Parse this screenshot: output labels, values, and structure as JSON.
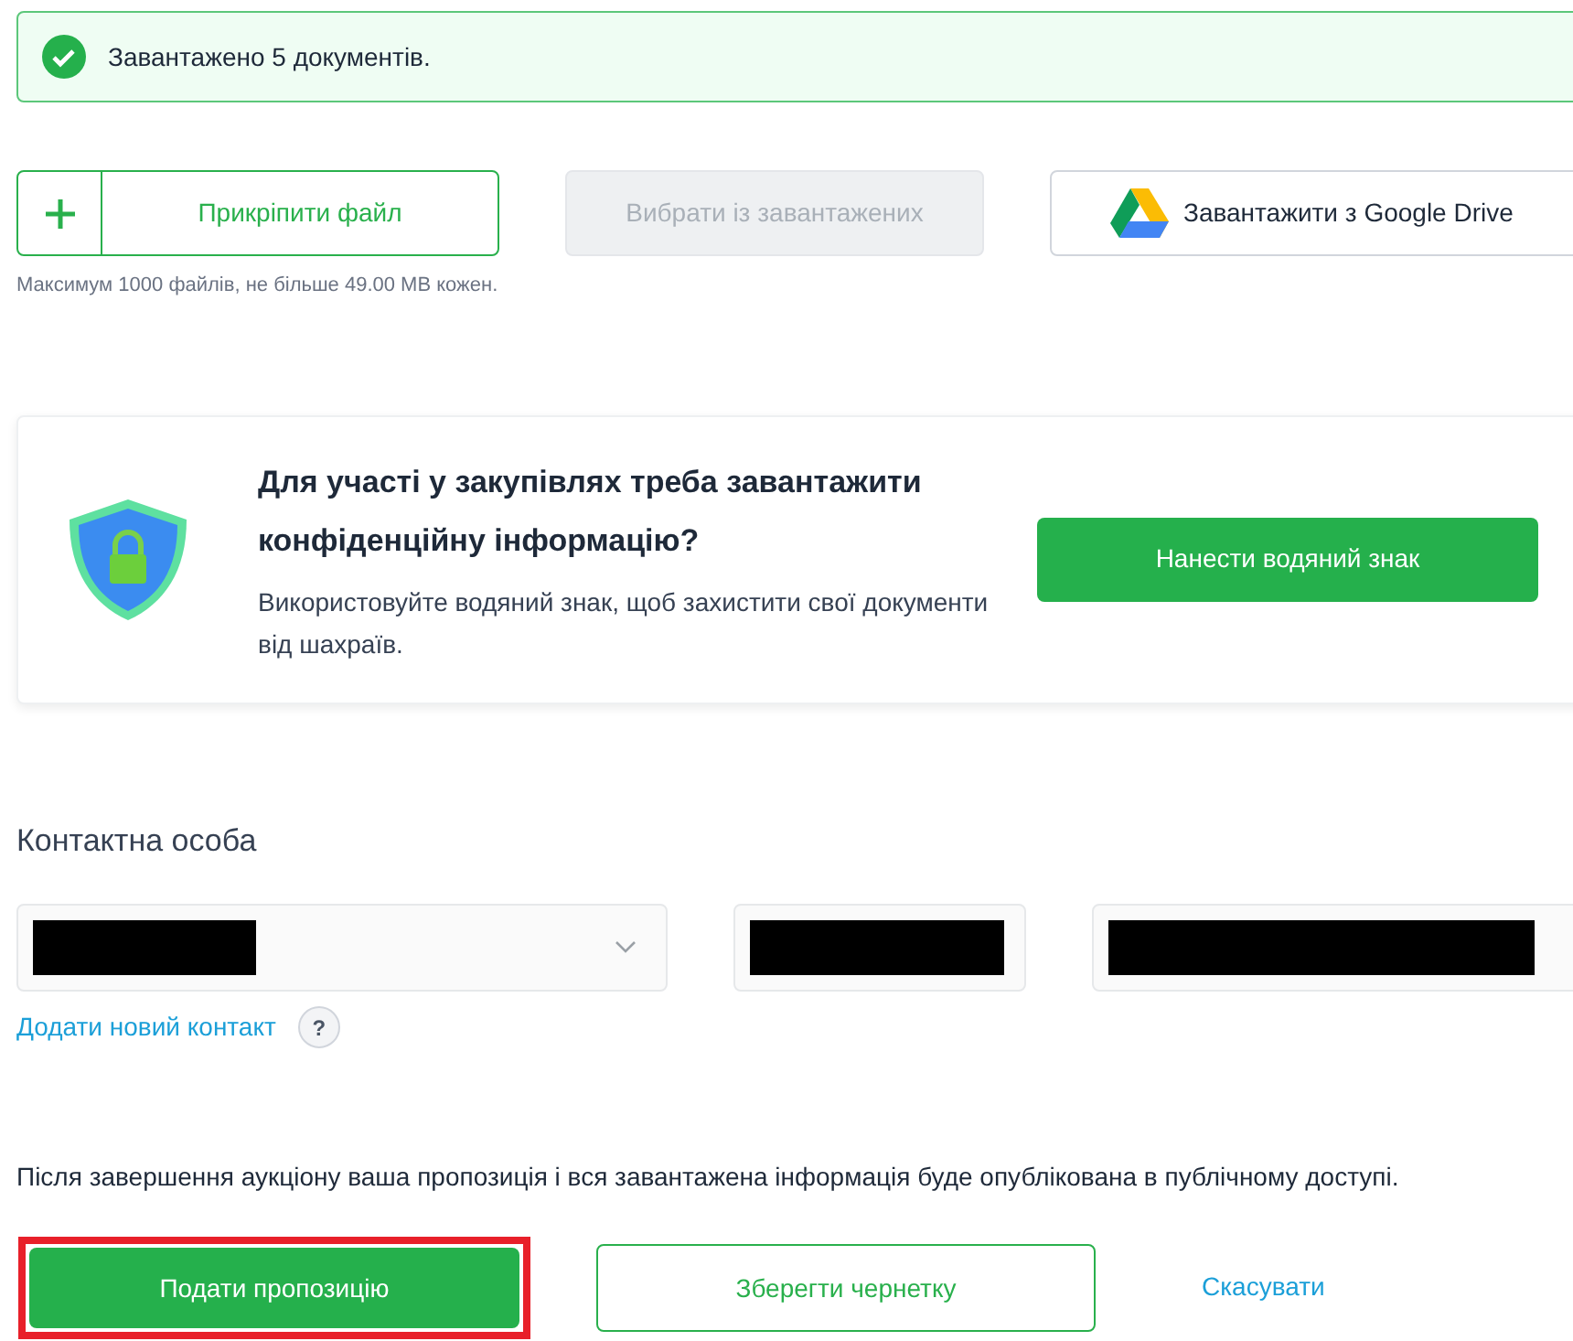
{
  "alert": {
    "text": "Завантажено 5 документів."
  },
  "upload": {
    "buttons": [
      {
        "kind": "attach",
        "label": "Прикріпити файл",
        "disabled": false
      },
      {
        "kind": "plain",
        "label": "Вибрати із завантажених",
        "disabled": true
      },
      {
        "kind": "drive",
        "label": "Завантажити з Google Drive",
        "disabled": false
      }
    ],
    "hint": "Максимум 1000 файлів, не більше 49.00 MB кожен."
  },
  "watermark_card": {
    "title": "Для участі у закупівлях треба завантажити конфіденційну інформацію?",
    "text": "Використовуйте водяний знак, щоб захистити свої документи від шахраїв.",
    "button": "Нанести водяний знак"
  },
  "contact": {
    "heading": "Контактна особа",
    "fields": [
      {
        "kind": "select",
        "redacted": true
      },
      {
        "kind": "text",
        "redacted": true
      },
      {
        "kind": "text",
        "redacted": true
      }
    ],
    "add_link": "Додати новий контакт",
    "help": "?"
  },
  "notice": "Після завершення аукціону ваша пропозиція і вся завантажена інформація буде опублікована в публічному доступі.",
  "actions": [
    {
      "kind": "primary",
      "label": "Подати пропозицію",
      "highlighted": true
    },
    {
      "kind": "outline",
      "label": "Зберегти чернетку",
      "highlighted": false
    },
    {
      "kind": "link",
      "label": "Скасувати",
      "highlighted": false
    }
  ]
}
